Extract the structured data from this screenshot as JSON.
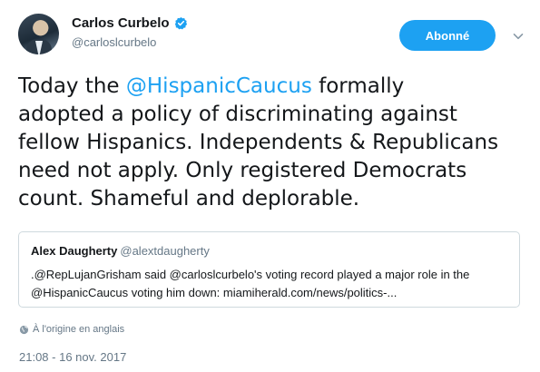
{
  "author": {
    "display_name": "Carlos Curbelo",
    "handle": "@carloslcurbelo",
    "verified": true
  },
  "follow_button": {
    "label": "Abonné"
  },
  "tweet": {
    "line1_pre": "Today the ",
    "line1_mention": "@HispanicCaucus",
    "line1_post": " formally",
    "line2": "adopted a policy of discriminating against",
    "line3": "fellow Hispanics. Independents & Republicans",
    "line4": "need not apply. Only registered Democrats",
    "line5": "count. Shameful and deplorable."
  },
  "quote": {
    "name": "Alex Daugherty",
    "handle": "@alextdaugherty",
    "line1": ".@RepLujanGrisham said @carloslcurbelo's voting record played a major role in the",
    "line2": "@HispanicCaucus voting him down: miamiherald.com/news/politics-..."
  },
  "translation_note": "À l'origine en anglais",
  "timestamp": "21:08 - 16 nov. 2017",
  "colors": {
    "accent": "#1da1f2",
    "secondary_text": "#657786",
    "primary_text": "#14171a",
    "border": "#cfd9de"
  },
  "icons": {
    "verified": "verified-badge-icon",
    "caret": "chevron-down-icon",
    "globe": "globe-icon"
  }
}
